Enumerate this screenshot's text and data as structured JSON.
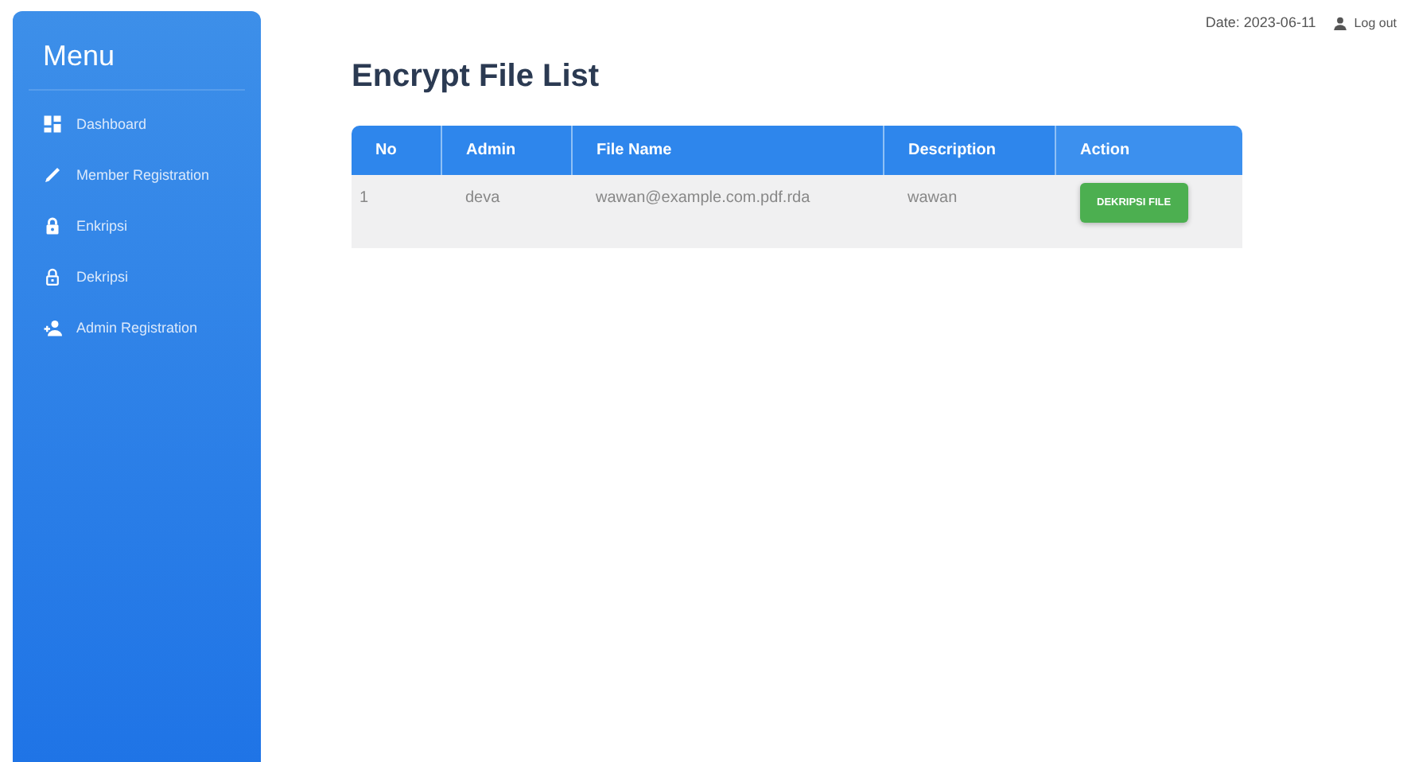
{
  "sidebar": {
    "title": "Menu",
    "items": [
      {
        "label": "Dashboard"
      },
      {
        "label": "Member Registration"
      },
      {
        "label": "Enkripsi"
      },
      {
        "label": "Dekripsi"
      },
      {
        "label": "Admin Registration"
      }
    ]
  },
  "header": {
    "date": "Date: 2023-06-11",
    "logout": "Log out"
  },
  "page_title": "Encrypt File List",
  "table": {
    "columns": [
      "No",
      "Admin",
      "File Name",
      "Description",
      "Action"
    ],
    "rows": [
      {
        "no": "1",
        "admin": "deva",
        "file_name": "wawan@example.com.pdf.rda",
        "description": "wawan",
        "action": "DEKRIPSI FILE"
      }
    ]
  }
}
